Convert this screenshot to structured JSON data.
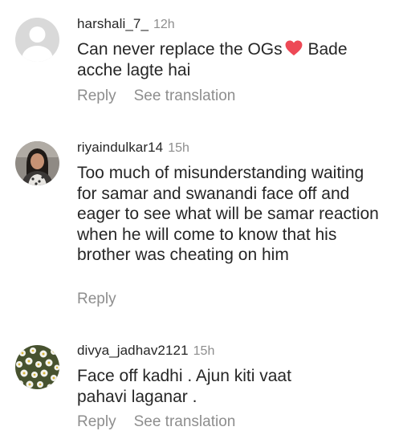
{
  "comments": [
    {
      "username": "harshali_7_",
      "time": "12h",
      "text_before_icon": "Can never replace the OGs",
      "icon": "red-heart-icon",
      "text_after_icon": " Bade acche lagte hai",
      "reply_label": "Reply",
      "translation_label": "See translation"
    },
    {
      "username": "riyaindulkar14",
      "time": "15h",
      "text": "Too much of misunderstanding waiting for samar and swanandi face off  and eager to see what will be samar reaction when he will come to know that his brother was cheating on him",
      "reply_label": "Reply"
    },
    {
      "username": "divya_jadhav2121",
      "time": "15h",
      "text": "Face off kadhi . Ajun kiti vaat pahavi laganar .",
      "reply_label": "Reply",
      "translation_label": "See translation"
    }
  ],
  "colors": {
    "text": "#262626",
    "secondary": "#8e8e8e",
    "heart": "#ed4956",
    "background": "#ffffff"
  }
}
